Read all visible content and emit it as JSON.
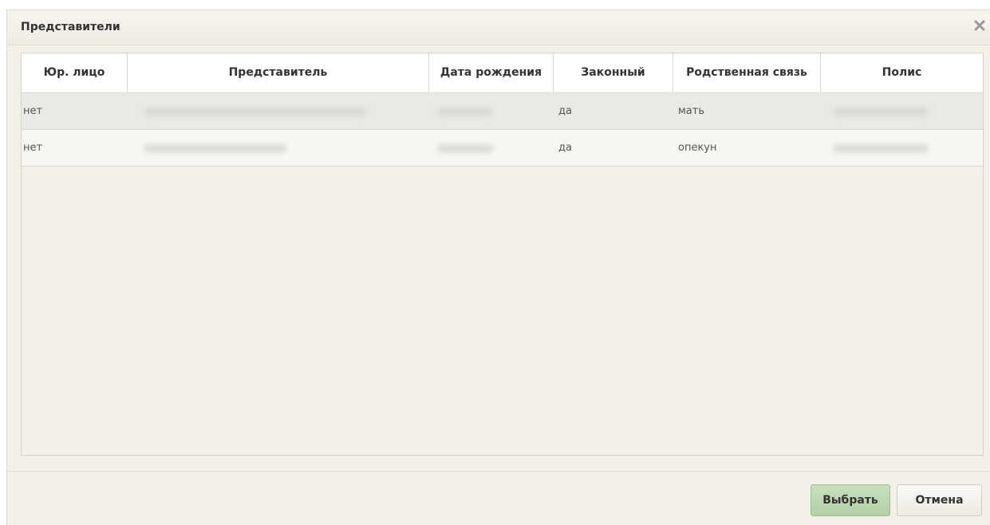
{
  "dialog": {
    "title": "Представители",
    "close_icon": "close-icon"
  },
  "table": {
    "columns": [
      "Юр. лицо",
      "Представитель",
      "Дата рождения",
      "Законный",
      "Родственная связь",
      "Полис"
    ],
    "rows": [
      {
        "legal_entity": "нет",
        "representative": "",
        "birth_date": "",
        "legal": "да",
        "relation": "мать",
        "policy": ""
      },
      {
        "legal_entity": "нет",
        "representative": "",
        "birth_date": "",
        "legal": "да",
        "relation": "опекун",
        "policy": ""
      }
    ]
  },
  "buttons": {
    "select_label": "Выбрать",
    "cancel_label": "Отмена"
  },
  "colors": {
    "dialog_bg": "#f3f1e7",
    "select_button": "#bcd7ae"
  }
}
